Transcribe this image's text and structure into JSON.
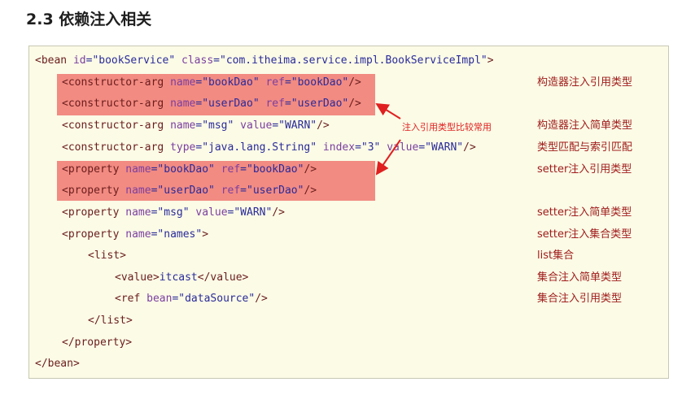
{
  "heading": "2.3 依赖注入相关",
  "code_lines": [
    [
      {
        "t": "<bean ",
        "c": "tag"
      },
      {
        "t": "id",
        "c": "attr"
      },
      {
        "t": "=\"bookService\" ",
        "c": "val"
      },
      {
        "t": "class",
        "c": "attr"
      },
      {
        "t": "=\"com.itheima.service.impl.BookServiceImpl\"",
        "c": "val"
      },
      {
        "t": ">",
        "c": "tag"
      }
    ],
    [
      {
        "t": "<constructor-arg ",
        "c": "tag"
      },
      {
        "t": "name",
        "c": "attr"
      },
      {
        "t": "=\"bookDao\" ",
        "c": "val"
      },
      {
        "t": "ref",
        "c": "attr"
      },
      {
        "t": "=\"bookDao\"",
        "c": "val"
      },
      {
        "t": "/>",
        "c": "tag"
      }
    ],
    [
      {
        "t": "<constructor-arg ",
        "c": "tag"
      },
      {
        "t": "name",
        "c": "attr"
      },
      {
        "t": "=\"userDao\" ",
        "c": "val"
      },
      {
        "t": "ref",
        "c": "attr"
      },
      {
        "t": "=\"userDao\"",
        "c": "val"
      },
      {
        "t": "/>",
        "c": "tag"
      }
    ],
    [
      {
        "t": "<constructor-arg ",
        "c": "tag"
      },
      {
        "t": "name",
        "c": "attr"
      },
      {
        "t": "=\"msg\" ",
        "c": "val"
      },
      {
        "t": "value",
        "c": "attr"
      },
      {
        "t": "=\"WARN\"",
        "c": "val"
      },
      {
        "t": "/>",
        "c": "tag"
      }
    ],
    [
      {
        "t": "<constructor-arg ",
        "c": "tag"
      },
      {
        "t": "type",
        "c": "attr"
      },
      {
        "t": "=\"java.lang.String\" ",
        "c": "val"
      },
      {
        "t": "index",
        "c": "attr"
      },
      {
        "t": "=\"3\" ",
        "c": "val"
      },
      {
        "t": "value",
        "c": "attr"
      },
      {
        "t": "=\"WARN\"",
        "c": "val"
      },
      {
        "t": "/>",
        "c": "tag"
      }
    ],
    [
      {
        "t": "<property ",
        "c": "tag"
      },
      {
        "t": "name",
        "c": "attr"
      },
      {
        "t": "=\"bookDao\" ",
        "c": "val"
      },
      {
        "t": "ref",
        "c": "attr"
      },
      {
        "t": "=\"bookDao\"",
        "c": "val"
      },
      {
        "t": "/>",
        "c": "tag"
      }
    ],
    [
      {
        "t": "<property ",
        "c": "tag"
      },
      {
        "t": "name",
        "c": "attr"
      },
      {
        "t": "=\"userDao\" ",
        "c": "val"
      },
      {
        "t": "ref",
        "c": "attr"
      },
      {
        "t": "=\"userDao\"",
        "c": "val"
      },
      {
        "t": "/>",
        "c": "tag"
      }
    ],
    [
      {
        "t": "<property ",
        "c": "tag"
      },
      {
        "t": "name",
        "c": "attr"
      },
      {
        "t": "=\"msg\" ",
        "c": "val"
      },
      {
        "t": "value",
        "c": "attr"
      },
      {
        "t": "=\"WARN\"",
        "c": "val"
      },
      {
        "t": "/>",
        "c": "tag"
      }
    ],
    [
      {
        "t": "<property ",
        "c": "tag"
      },
      {
        "t": "name",
        "c": "attr"
      },
      {
        "t": "=\"names\"",
        "c": "val"
      },
      {
        "t": ">",
        "c": "tag"
      }
    ],
    [
      {
        "t": "<list>",
        "c": "tag"
      }
    ],
    [
      {
        "t": "<value>",
        "c": "tag"
      },
      {
        "t": "itcast",
        "c": "val"
      },
      {
        "t": "</value>",
        "c": "tag"
      }
    ],
    [
      {
        "t": "<ref ",
        "c": "tag"
      },
      {
        "t": "bean",
        "c": "attr"
      },
      {
        "t": "=\"dataSource\"",
        "c": "val"
      },
      {
        "t": "/>",
        "c": "tag"
      }
    ],
    [
      {
        "t": "</list>",
        "c": "tag"
      }
    ],
    [
      {
        "t": "</property>",
        "c": "tag"
      }
    ],
    [
      {
        "t": "</bean>",
        "c": "tag"
      }
    ]
  ],
  "annotations": [
    {
      "line": 1,
      "text": "构造器注入引用类型"
    },
    {
      "line": 3,
      "text": "构造器注入简单类型"
    },
    {
      "line": 4,
      "text": "类型匹配与索引匹配"
    },
    {
      "line": 5,
      "text": "setter注入引用类型"
    },
    {
      "line": 7,
      "text": "setter注入简单类型"
    },
    {
      "line": 8,
      "text": "setter注入集合类型"
    },
    {
      "line": 9,
      "text": "list集合"
    },
    {
      "line": 10,
      "text": "集合注入简单类型"
    },
    {
      "line": 11,
      "text": "集合注入引用类型"
    }
  ],
  "callout": "注入引用类型比较常用",
  "colors": {
    "highlight": "#f28b82",
    "box_bg": "#fbfbe6",
    "annotation": "#a01c1c",
    "callout": "#e02020"
  }
}
